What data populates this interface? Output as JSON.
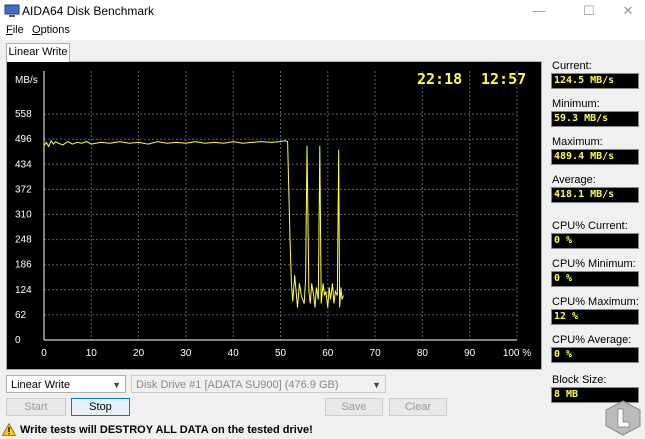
{
  "window": {
    "title": "AIDA64 Disk Benchmark"
  },
  "menu": {
    "file": "File",
    "file_key": "F",
    "file_rest": "ile",
    "options_key": "O",
    "options_rest": "ptions"
  },
  "tab": {
    "label": "Linear Write"
  },
  "chart_data": {
    "type": "line",
    "ylabel": "MB/s",
    "y_ticks": [
      "558",
      "496",
      "434",
      "372",
      "310",
      "248",
      "186",
      "124",
      "62",
      "0"
    ],
    "x_ticks": [
      "0",
      "10",
      "20",
      "30",
      "40",
      "50",
      "60",
      "70",
      "80",
      "90",
      "100 %"
    ],
    "ylim": [
      0,
      620
    ],
    "xlim": [
      0,
      100
    ],
    "grid": true,
    "elapsed_time": "22:18",
    "clock_time": "12:57",
    "line_color": "#ffff40",
    "series": [
      {
        "x": [
          0,
          0.5,
          1,
          1.5,
          2,
          2.5,
          3,
          4,
          5,
          6,
          7,
          8,
          9,
          10,
          12,
          14,
          16,
          18,
          20,
          22,
          24,
          26,
          28,
          30,
          32,
          34,
          36,
          38,
          40,
          42,
          44,
          46,
          48,
          50,
          51,
          51.5,
          52,
          52.3,
          52.6,
          53,
          53.3,
          53.6,
          54,
          54.4,
          54.7,
          55,
          55.3,
          55.6,
          56,
          56.3,
          56.6,
          57,
          57.3,
          57.6,
          58,
          58.3,
          58.6,
          59,
          59.3,
          59.6,
          60,
          60.3,
          60.6,
          61,
          61.3,
          61.6,
          62,
          62.3,
          62.5,
          62.8,
          63,
          63.3
        ],
        "y": [
          480,
          488,
          478,
          492,
          484,
          490,
          486,
          482,
          490,
          484,
          488,
          486,
          490,
          484,
          488,
          486,
          490,
          486,
          488,
          484,
          490,
          486,
          488,
          486,
          490,
          486,
          488,
          486,
          490,
          486,
          488,
          490,
          488,
          490,
          492,
          490,
          250,
          140,
          95,
          160,
          120,
          80,
          140,
          110,
          100,
          90,
          150,
          480,
          120,
          90,
          140,
          110,
          80,
          130,
          100,
          480,
          90,
          140,
          110,
          120,
          80,
          130,
          100,
          140,
          90,
          120,
          110,
          470,
          80,
          130,
          100,
          110
        ]
      }
    ]
  },
  "stats": [
    {
      "label": "Current:",
      "value": "124.5 MB/s"
    },
    {
      "label": "Minimum:",
      "value": "59.3 MB/s"
    },
    {
      "label": "Maximum:",
      "value": "489.4 MB/s"
    },
    {
      "label": "Average:",
      "value": "418.1 MB/s"
    },
    {
      "label": "CPU% Current:",
      "value": "0 %"
    },
    {
      "label": "CPU% Minimum:",
      "value": "0 %"
    },
    {
      "label": "CPU% Maximum:",
      "value": "12 %"
    },
    {
      "label": "CPU% Average:",
      "value": "0 %"
    },
    {
      "label": "Block Size:",
      "value": "8 MB"
    }
  ],
  "controls": {
    "test_select": "Linear Write",
    "drive_select": "Disk Drive #1  [ADATA SU900]  (476.9 GB)",
    "start": "Start",
    "stop": "Stop",
    "save": "Save",
    "clear": "Clear"
  },
  "warning": {
    "text": "Write tests will DESTROY ALL DATA on the tested drive!"
  },
  "colors": {
    "graph_bg": "#000000",
    "grid": "#606060",
    "trace": "#ffff40",
    "accent": "#0078d7"
  }
}
